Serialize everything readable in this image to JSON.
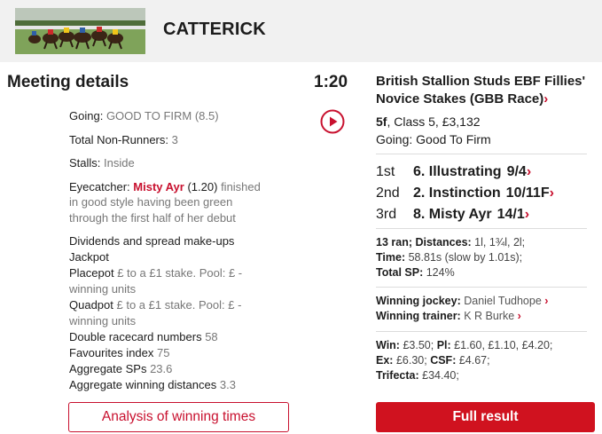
{
  "header": {
    "course_name": "CATTERICK",
    "thumbnail_icon": "racehorses-photo"
  },
  "meeting": {
    "title": "Meeting details",
    "going_label": "Going:",
    "going_value": "GOOD TO FIRM (8.5)",
    "non_runners_label": "Total Non-Runners:",
    "non_runners_value": "3",
    "stalls_label": "Stalls:",
    "stalls_value": "Inside",
    "eyecatcher_label": "Eyecatcher:",
    "eyecatcher_horse": "Misty Ayr",
    "eyecatcher_time": "(1.20)",
    "eyecatcher_text_1": "finished",
    "eyecatcher_text_2": "in good style having been green",
    "eyecatcher_text_3": "through the first half of her debut",
    "dividends_title": "Dividends and spread make-ups",
    "jackpot_label": "Jackpot",
    "placepot_label": "Placepot",
    "placepot_value_1": "£ to a £1 stake. Pool: £ -",
    "placepot_value_2": "winning units",
    "quadpot_label": "Quadpot",
    "quadpot_value_1": "£ to a £1 stake. Pool: £ -",
    "quadpot_value_2": "winning units",
    "double_label": "Double racecard numbers",
    "double_value": "58",
    "favourites_label": "Favourites index",
    "favourites_value": "75",
    "agg_sp_label": "Aggregate SPs",
    "agg_sp_value": "23.6",
    "agg_dist_label": "Aggregate winning distances",
    "agg_dist_value": "3.3",
    "analysis_button": "Analysis of winning times"
  },
  "race": {
    "time": "1:20",
    "play_icon": "play-circle-icon",
    "title": "British Stallion Studs EBF Fillies' Novice Stakes (GBB Race)",
    "chevron": "›",
    "distance": "5f",
    "class_prize": ", Class 5, £3,132",
    "going": "Going: Good To Firm",
    "placings": [
      {
        "pos": "1st",
        "horse": "6. Illustrating",
        "sp": "9/4"
      },
      {
        "pos": "2nd",
        "horse": "2. Instinction",
        "sp": "10/11F"
      },
      {
        "pos": "3rd",
        "horse": "8. Misty Ayr",
        "sp": "14/1"
      }
    ],
    "ran_label": "13 ran; Distances:",
    "distances_value": "1l, 1¾l, 2l;",
    "time_label": "Time:",
    "time_value": "58.81s (slow by 1.01s);",
    "total_sp_label": "Total SP:",
    "total_sp_value": "124%",
    "jockey_label": "Winning jockey:",
    "jockey_value": "Daniel Tudhope",
    "trainer_label": "Winning trainer:",
    "trainer_value": "K R Burke",
    "win_label": "Win:",
    "win_value": "£3.50;",
    "pl_label": "Pl:",
    "pl_value": "£1.60, £1.10, £4.20;",
    "ex_label": "Ex:",
    "ex_value": "£6.30;",
    "csf_label": "CSF:",
    "csf_value": "£4.67;",
    "trifecta_label": "Trifecta:",
    "trifecta_value": "£34.40;",
    "full_result_button": "Full result"
  },
  "colors": {
    "accent": "#c8102e",
    "button_red": "#d0121f",
    "header_bg": "#f1f1f1",
    "muted_text": "#777777"
  }
}
